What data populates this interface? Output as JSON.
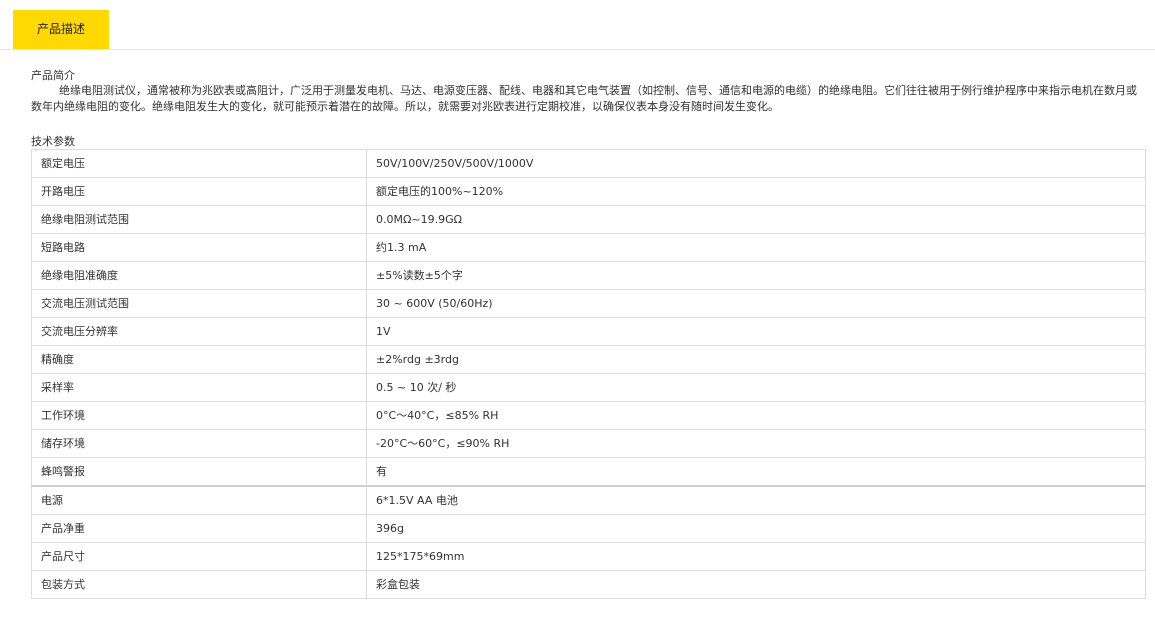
{
  "tabs": [
    {
      "label": "产品描述",
      "active": true
    }
  ],
  "intro": {
    "title": "产品简介",
    "text": "绝缘电阻测试仪，通常被称为兆欧表或高阻计，广泛用于测量发电机、马达、电源变压器、配线、电器和其它电气装置（如控制、信号、通信和电源的电缆）的绝缘电阻。它们往往被用于例行维护程序中来指示电机在数月或数年内绝缘电阻的变化。绝缘电阻发生大的变化，就可能预示着潜在的故障。所以，就需要对兆欧表进行定期校准，以确保仪表本身没有随时间发生变化。"
  },
  "specs": {
    "title": "技术参数",
    "rows": [
      {
        "key": "额定电压",
        "value": "50V/100V/250V/500V/1000V"
      },
      {
        "key": "开路电压",
        "value": "额定电压的100%~120%"
      },
      {
        "key": "绝缘电阻测试范围",
        "value": "0.0MΩ~19.9GΩ"
      },
      {
        "key": "短路电路",
        "value": "约1.3 mA"
      },
      {
        "key": "绝缘电阻准确度",
        "value": "±5%读数±5个字"
      },
      {
        "key": "交流电压测试范围",
        "value": "30 ~ 600V (50/60Hz)"
      },
      {
        "key": "交流电压分辨率",
        "value": "1V"
      },
      {
        "key": "精确度",
        "value": "±2%rdg ±3rdg"
      },
      {
        "key": "采样率",
        "value": "0.5 ~ 10 次/ 秒"
      },
      {
        "key": "工作环境",
        "value": "0°C～40°C，≤85% RH"
      },
      {
        "key": "储存环境",
        "value": "-20°C～60°C，≤90% RH"
      },
      {
        "key": "蜂鸣警报",
        "value": "有"
      },
      {
        "key": "电源",
        "value": "6*1.5V AA 电池"
      },
      {
        "key": "产品净重",
        "value": "396g"
      },
      {
        "key": "产品尺寸",
        "value": "125*175*69mm"
      },
      {
        "key": "包装方式",
        "value": "彩盒包装"
      }
    ]
  },
  "colors": {
    "tab_active_bg": "#ffd900",
    "border": "#dcdcdc",
    "text": "#333333"
  }
}
